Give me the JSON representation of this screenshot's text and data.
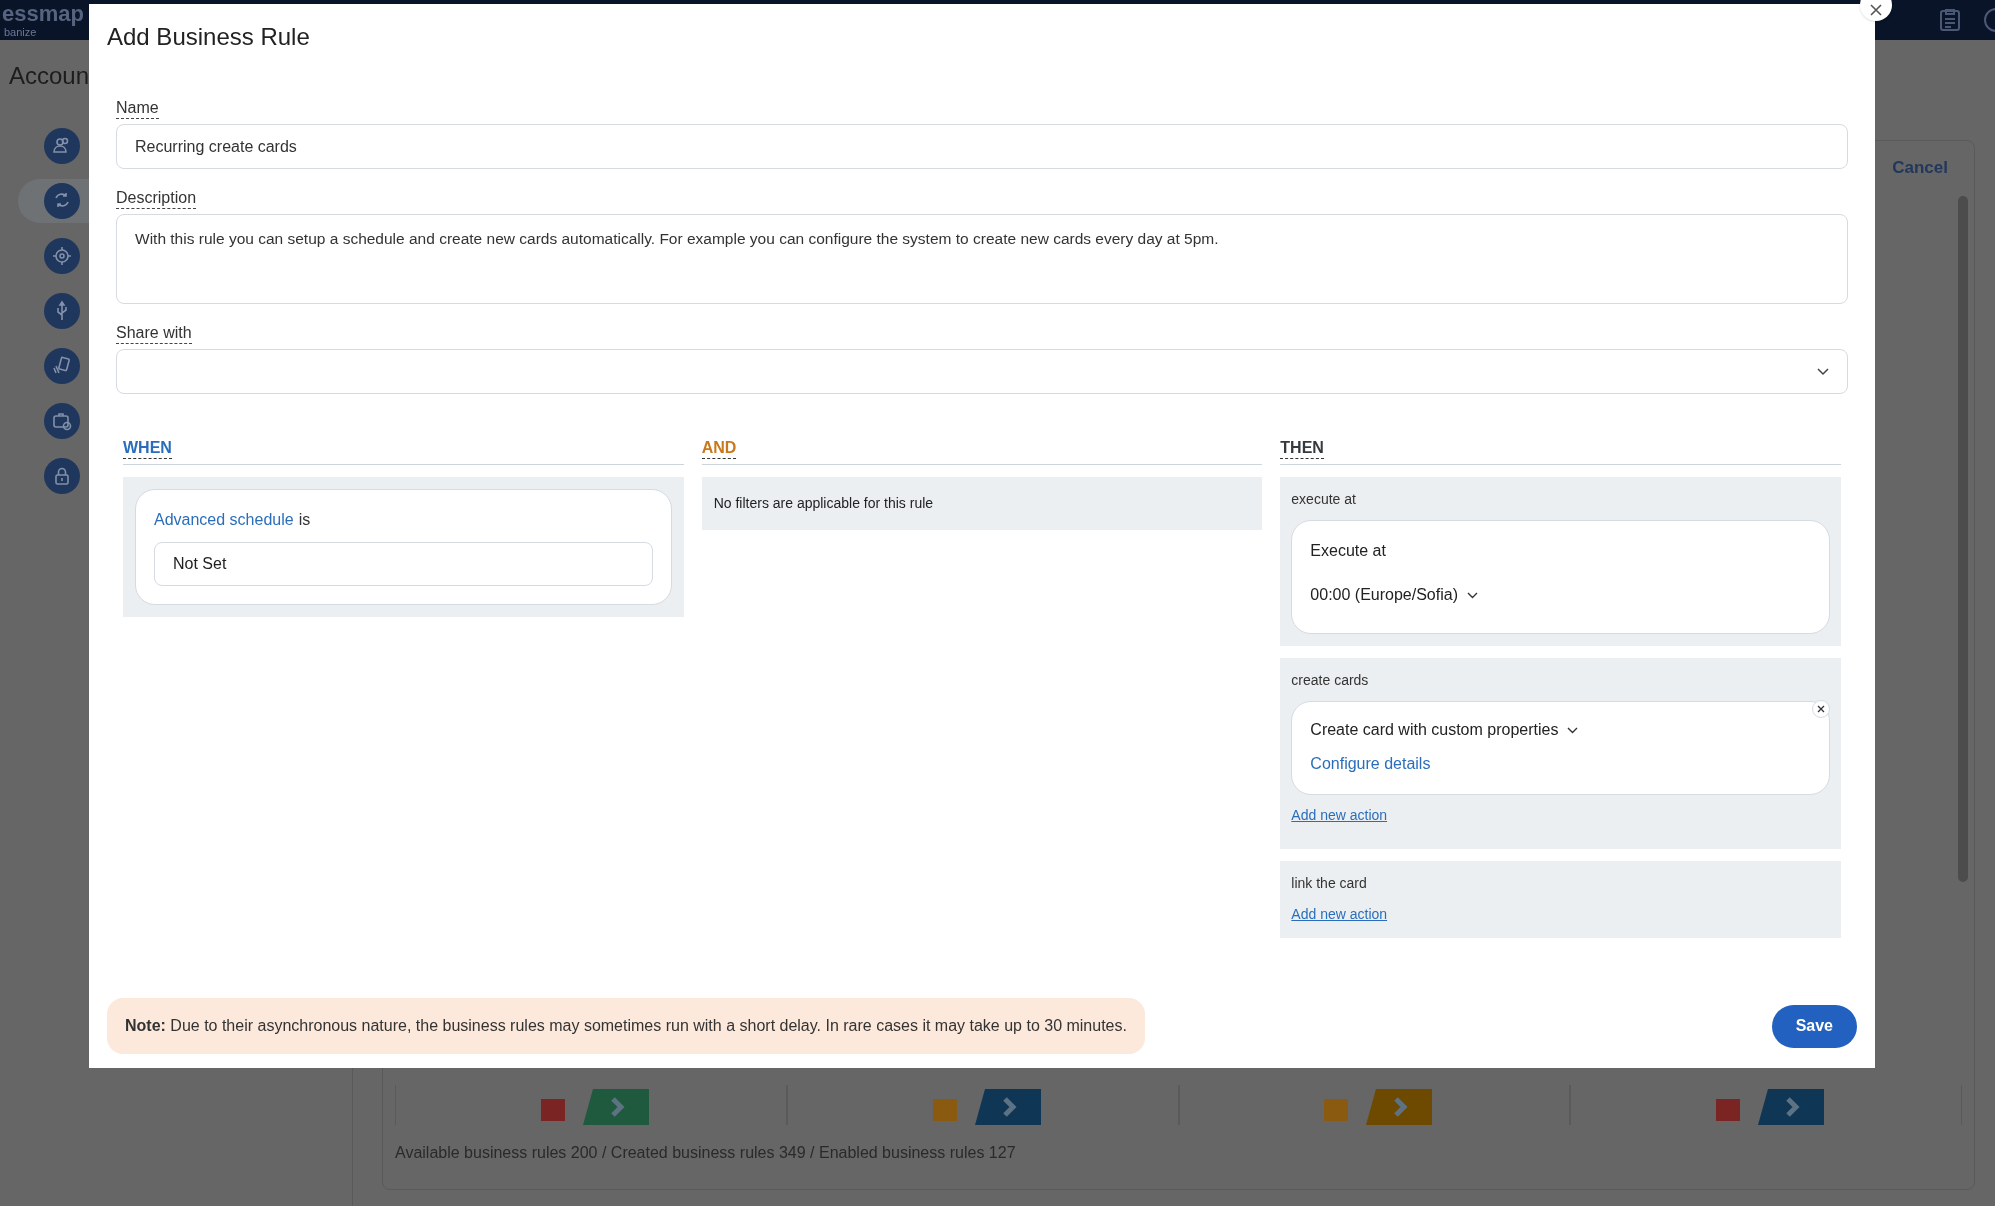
{
  "background": {
    "logo": "essmap",
    "logo_subtitle": "banize",
    "page_title": "Accoun",
    "sidebar": [
      {
        "selected": false
      },
      {
        "selected": true
      },
      {
        "selected": false
      },
      {
        "selected": false
      },
      {
        "selected": false
      },
      {
        "selected": false
      },
      {
        "selected": false
      }
    ],
    "cancel": "Cancel",
    "summary": "Available business rules 200 / Created business rules 349 / Enabled business rules 127"
  },
  "dialog": {
    "title": "Add Business Rule",
    "fields": [
      {
        "label": "Name",
        "kind": "input",
        "value": "Recurring create cards"
      },
      {
        "label": "Description",
        "kind": "textarea",
        "value": "With this rule you can setup a schedule and create new cards automatically. For example you can configure the system to create new cards every day at 5pm."
      },
      {
        "label": "Share with",
        "kind": "select"
      }
    ],
    "when": {
      "heading": "WHEN",
      "color": "#2a6ebb",
      "condition_field": "Advanced schedule",
      "condition_operator": "is",
      "condition_value": "Not Set"
    },
    "and": {
      "heading": "AND",
      "color": "#c9781c",
      "message": "No filters are applicable for this rule"
    },
    "then": {
      "heading": "THEN",
      "color": "#333a40",
      "sections": [
        {
          "title": "execute at",
          "kind": "schedule",
          "label": "Execute at",
          "value": "00:00 (Europe/Sofia)"
        },
        {
          "title": "create cards",
          "kind": "action",
          "value": "Create card with custom properties",
          "link": "Configure details",
          "add_link": "Add new action"
        },
        {
          "title": "link the card",
          "kind": "empty",
          "add_link": "Add new action"
        }
      ]
    },
    "note": "**Note:** Due to their asynchronous nature, the business rules may sometimes run with a short delay. In rare cases it may take up to 30 minutes.",
    "save": "Save"
  }
}
